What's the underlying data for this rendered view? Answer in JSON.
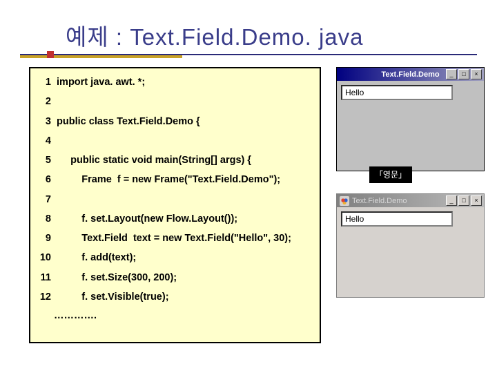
{
  "title": "예제 : Text.Field.Demo. java",
  "code": [
    {
      "n": "1",
      "t": " import java. awt. *;"
    },
    {
      "n": "2",
      "t": ""
    },
    {
      "n": "3",
      "t": " public class Text.Field.Demo {"
    },
    {
      "n": "4",
      "t": ""
    },
    {
      "n": "5",
      "t": "      public static void main(String[] args) {"
    },
    {
      "n": "6",
      "t": "          Frame  f = new Frame(\"Text.Field.Demo\");"
    },
    {
      "n": "7",
      "t": ""
    },
    {
      "n": "8",
      "t": "          f. set.Layout(new Flow.Layout());"
    },
    {
      "n": "9",
      "t": "          Text.Field  text = new Text.Field(\"Hello\", 30);"
    },
    {
      "n": "10",
      "t": "          f. add(text);"
    },
    {
      "n": "11",
      "t": "          f. set.Size(300, 200);"
    },
    {
      "n": "12",
      "t": "          f. set.Visible(true);"
    }
  ],
  "ellipsis": "………….",
  "win1": {
    "title": "Text.Field.Demo",
    "value": "Hello",
    "btn_min": "_",
    "btn_max": "□",
    "btn_close": "×"
  },
  "label_tag": "「영문」",
  "win2": {
    "title": "Text.Field.Demo",
    "value": "Hello",
    "btn_min": "_",
    "btn_max": "□",
    "btn_close": "×"
  }
}
